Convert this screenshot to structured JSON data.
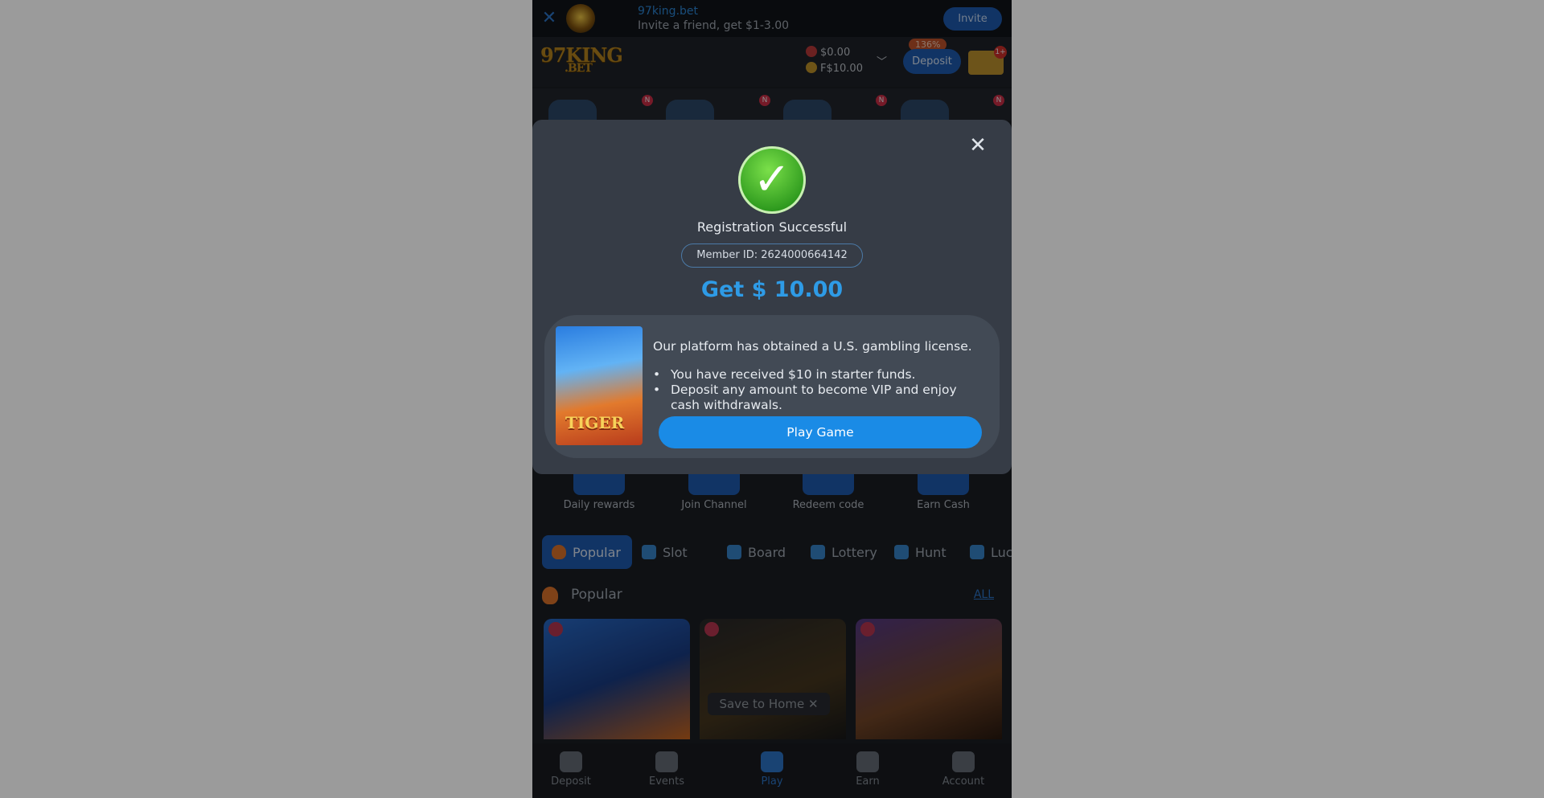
{
  "banner": {
    "close_icon": "close-icon",
    "site": "97king.bet",
    "promo": "Invite a friend, get $1-3.00",
    "invite_label": "Invite"
  },
  "header": {
    "brand_line1": "97KING",
    "brand_line2": ".BET",
    "balance_cash": "$0.00",
    "balance_bonus": "F$10.00",
    "bonus_pct": "136%",
    "deposit_label": "Deposit",
    "gift_badge": "1+"
  },
  "strip": {
    "badges": [
      "N",
      "N",
      "N",
      "N"
    ]
  },
  "quick_actions": [
    {
      "label": "Daily rewards"
    },
    {
      "label": "Join Channel"
    },
    {
      "label": "Redeem code"
    },
    {
      "label": "Earn Cash"
    }
  ],
  "tabs": [
    {
      "label": "Popular",
      "active": true
    },
    {
      "label": "Slot"
    },
    {
      "label": "Board"
    },
    {
      "label": "Lottery"
    },
    {
      "label": "Hunt"
    },
    {
      "label": "Luc"
    }
  ],
  "section": {
    "title": "Popular",
    "all_label": "ALL"
  },
  "save_to_home": "Save to Home ✕",
  "nav": [
    {
      "label": "Deposit"
    },
    {
      "label": "Events"
    },
    {
      "label": "Play",
      "active": true
    },
    {
      "label": "Earn"
    },
    {
      "label": "Account"
    }
  ],
  "modal": {
    "close_icon": "close-icon",
    "title": "Registration Successful",
    "member_id": "Member ID: 2624000664142",
    "get_amount": "Get $ 10.00",
    "thumb_logo": "TIGER",
    "license_text": "Our platform has obtained a U.S. gambling license.",
    "bullets": [
      "You have received $10 in starter funds.",
      "Deposit any amount to become VIP and enjoy cash withdrawals."
    ],
    "play_label": "Play Game"
  },
  "colors": {
    "accent": "#1f5fb8",
    "amount": "#2e9be6",
    "success": "#2e9a1e"
  }
}
